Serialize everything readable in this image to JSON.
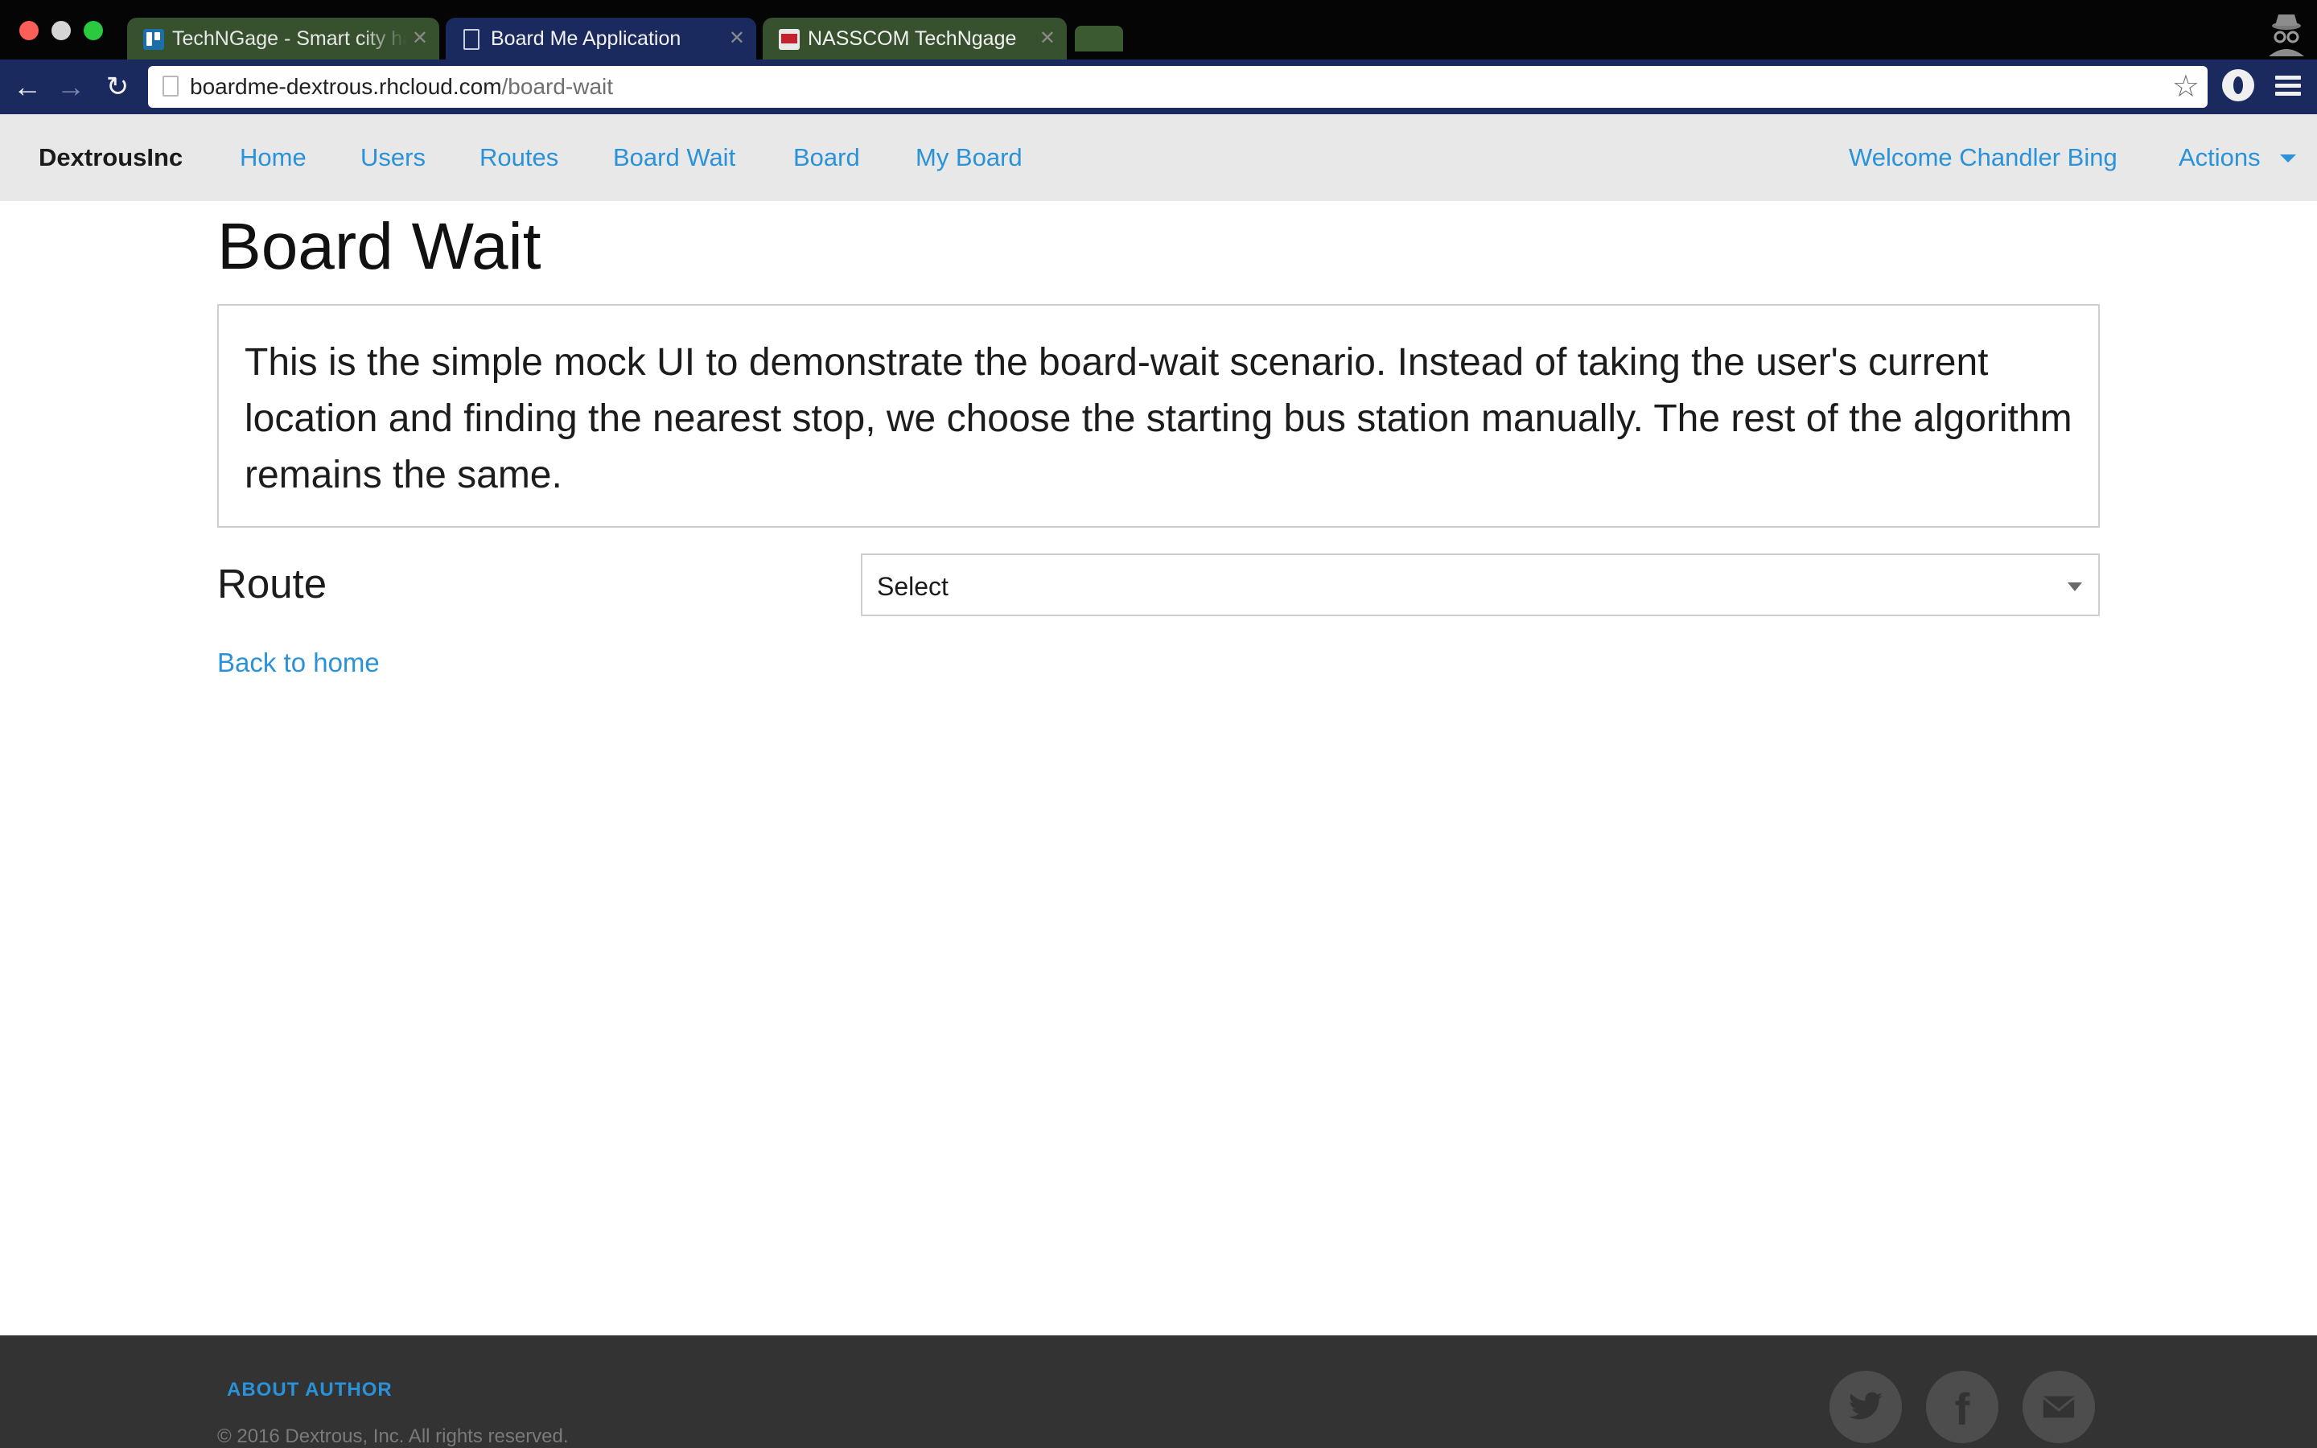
{
  "browser": {
    "tabs": [
      {
        "title": "TechNGage - Smart city ha",
        "favicon": "trello-icon",
        "active": false
      },
      {
        "title": "Board Me Application",
        "favicon": "document-icon",
        "active": true
      },
      {
        "title": "NASSCOM TechNgage",
        "favicon": "nasscom-icon",
        "active": false
      }
    ],
    "close_glyph": "✕",
    "url_host": "boardme-dextrous.rhcloud.com",
    "url_path": "/board-wait",
    "icons": {
      "back": "←",
      "forward": "→",
      "reload": "↻",
      "star": "☆"
    },
    "colors": {
      "tab_strip": "#050505",
      "toolbar": "#1a2a5e",
      "inactive_tab": "#37502e"
    }
  },
  "navbar": {
    "brand": "DextrousInc",
    "links": [
      "Home",
      "Users",
      "Routes",
      "Board Wait",
      "Board",
      "My Board"
    ],
    "welcome": "Welcome Chandler Bing",
    "actions": "Actions",
    "colors": {
      "background": "#e8e8e8",
      "link": "#2a92d8"
    }
  },
  "main": {
    "title": "Board Wait",
    "info": "This is the simple mock UI to demonstrate the board-wait scenario. Instead of taking the user's current location and finding the nearest stop, we choose the starting bus station manually. The rest of the algorithm remains the same.",
    "route_label": "Route",
    "route_select_value": "Select",
    "back_link": "Back to home"
  },
  "footer": {
    "about": "ABOUT AUTHOR",
    "copyright": "© 2016 Dextrous, Inc. All rights reserved.",
    "social": [
      "twitter-icon",
      "facebook-icon",
      "mail-icon"
    ],
    "facebook_glyph": "f",
    "colors": {
      "background": "#333333",
      "social_circle": "#4d4d4d"
    }
  }
}
